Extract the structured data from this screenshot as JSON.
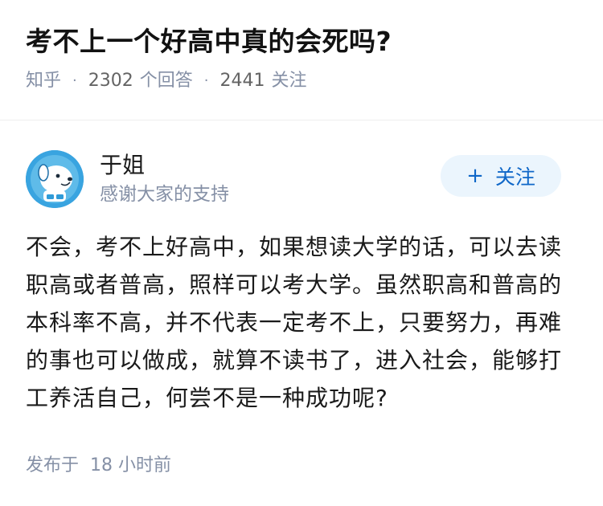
{
  "question": {
    "title": "考不上一个好高中真的会死吗?",
    "source": "知乎",
    "answer_count": "2302",
    "answer_unit": "个回答",
    "follower_count": "2441",
    "follower_unit": "关注",
    "separator": "·"
  },
  "answer": {
    "author_name": "于姐",
    "author_signature": "感谢大家的支持",
    "follow_label": "关注",
    "follow_plus": "+",
    "content": "不会，考不上好高中，如果想读大学的话，可以去读职高或者普高，照样可以考大学。虽然职高和普高的本科率不高，并不代表一定考不上，只要努力，再难的事也可以做成，就算不读书了，进入社会，能够打工养活自己，何尝不是一种成功呢?",
    "publish_label": "发布于",
    "publish_time": "18 小时前"
  },
  "colors": {
    "accent": "#0f67c8",
    "follow_bg": "#ebf5fd",
    "meta_gray": "#8590a6",
    "avatar_bg": "#2f9bd8"
  },
  "icons": {
    "avatar": "cartoon-dog-avatar-icon"
  }
}
